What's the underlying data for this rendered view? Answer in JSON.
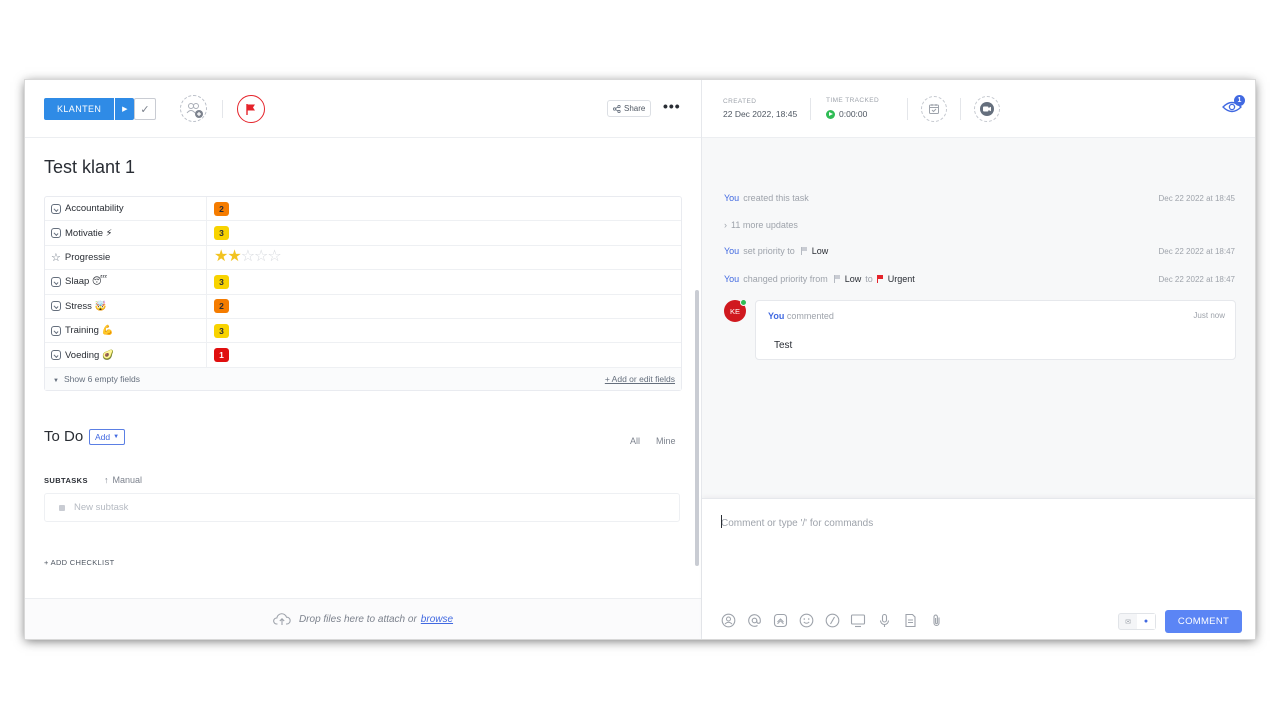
{
  "task": {
    "status_label": "KLANTEN",
    "share_label": "Share",
    "more_label": "•••",
    "title": "Test klant 1"
  },
  "fields": [
    {
      "name": "Accountability",
      "value": "2",
      "color": "#f57c00",
      "type": "dropdown"
    },
    {
      "name": "Motivatie ⚡",
      "value": "3",
      "color": "#f8d300",
      "type": "dropdown"
    },
    {
      "name": "Progressie",
      "rating": 2,
      "rating_max": 5,
      "type": "rating"
    },
    {
      "name": "Slaap 😴",
      "value": "3",
      "color": "#f8d300",
      "type": "dropdown"
    },
    {
      "name": "Stress 🤯",
      "value": "2",
      "color": "#f57c00",
      "type": "dropdown"
    },
    {
      "name": "Training 💪",
      "value": "3",
      "color": "#f8d300",
      "type": "dropdown"
    },
    {
      "name": "Voeding 🥑",
      "value": "1",
      "color": "#e00f0f",
      "type": "dropdown"
    }
  ],
  "fields_footer": {
    "show_empty": "Show 6 empty fields",
    "add_edit": "+ Add or edit fields"
  },
  "todo": {
    "title": "To Do",
    "add_label": "Add",
    "filter_all": "All",
    "filter_mine": "Mine",
    "subtasks_label": "SUBTASKS",
    "sort_label": "Manual",
    "new_subtask_placeholder": "New subtask",
    "add_checklist": "+ ADD CHECKLIST"
  },
  "dropzone": {
    "text": "Drop files here to attach or",
    "browse": "browse"
  },
  "meta": {
    "created_label": "CREATED",
    "created_value": "22 Dec 2022, 18:45",
    "time_label": "TIME TRACKED",
    "time_value": "0:00:00",
    "watchers_count": "1"
  },
  "activity": [
    {
      "who": "You",
      "text": "created this task",
      "time": "Dec 22 2022 at 18:45"
    },
    {
      "more": "11 more updates"
    },
    {
      "who": "You",
      "text": "set priority to",
      "to": "Low",
      "time": "Dec 22 2022 at 18:47"
    },
    {
      "who": "You",
      "text": "changed priority from",
      "from": "Low",
      "joiner": "to",
      "to": "Urgent",
      "time": "Dec 22 2022 at 18:47"
    }
  ],
  "comment": {
    "avatar_initials": "KE",
    "who": "You",
    "action": "commented",
    "time": "Just now",
    "text": "Test"
  },
  "composer": {
    "placeholder": "Comment or type '/' for commands",
    "submit_label": "COMMENT"
  },
  "colors": {
    "accent": "#4169e1",
    "status": "#2f8be6",
    "urgent": "#e5242b",
    "comment_button": "#5b85f5"
  }
}
